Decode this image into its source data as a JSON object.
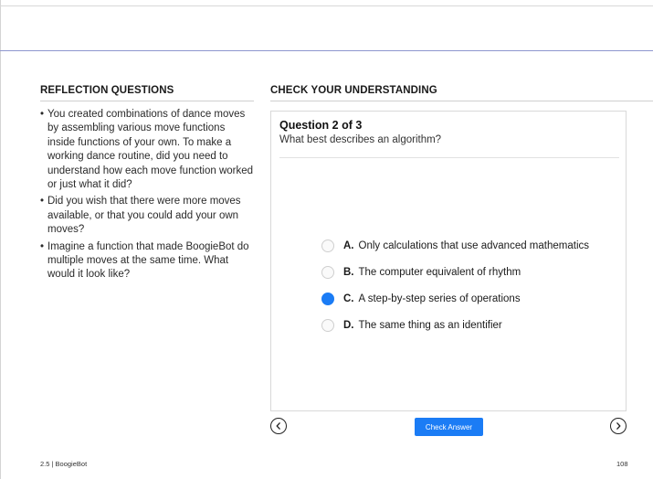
{
  "reflection": {
    "heading": "REFLECTION QUESTIONS",
    "items": [
      {
        "bullet": "•",
        "text": "You created combinations of dance moves by assembling various move functions inside functions of your own. To make a working dance routine, did you need to understand how each move function worked or just what it did?"
      },
      {
        "bullet": "•",
        "text": "Did you wish that there were more moves available, or that you could add your own moves?"
      },
      {
        "bullet": "•",
        "text": "Imagine a function that made BoogieBot do multiple moves at the same time. What would it look like?"
      }
    ]
  },
  "check": {
    "heading": "CHECK YOUR UNDERSTANDING",
    "question_label": "Question 2 of 3",
    "prompt": "What best describes an algorithm?",
    "options": [
      {
        "letter": "A.",
        "text": "Only calculations that use advanced mathematics",
        "selected": false
      },
      {
        "letter": "B.",
        "text": "The computer equivalent of rhythm",
        "selected": false
      },
      {
        "letter": "C.",
        "text": "A step-by-step series of operations",
        "selected": true
      },
      {
        "letter": "D.",
        "text": "The same thing as an identifier",
        "selected": false
      }
    ],
    "check_button_label": "Check Answer",
    "prev_icon": "chevron-left-icon",
    "next_icon": "chevron-right-icon"
  },
  "footer": {
    "section_label": "2.5 | BoogieBot",
    "page_number": "108"
  },
  "colors": {
    "accent": "#1b7cf5",
    "header_rule": "#8e97cf"
  }
}
